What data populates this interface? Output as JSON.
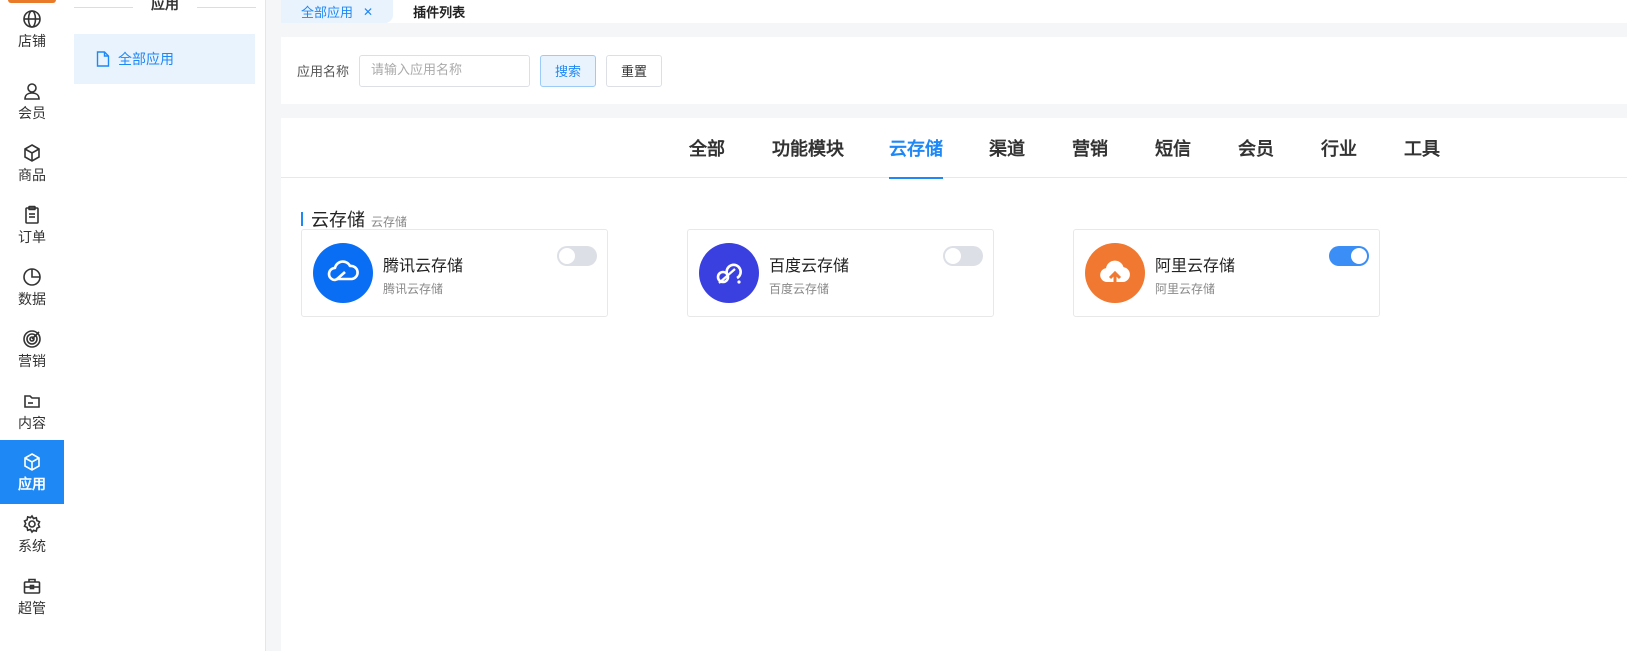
{
  "rail": {
    "items": [
      {
        "label": "店铺",
        "icon": "globe-icon"
      },
      {
        "label": "会员",
        "icon": "user-icon"
      },
      {
        "label": "商品",
        "icon": "box-icon"
      },
      {
        "label": "订单",
        "icon": "clipboard-icon"
      },
      {
        "label": "数据",
        "icon": "pie-chart-icon"
      },
      {
        "label": "营销",
        "icon": "target-icon"
      },
      {
        "label": "内容",
        "icon": "folder-icon"
      },
      {
        "label": "应用",
        "icon": "cube-icon",
        "active": true
      },
      {
        "label": "系统",
        "icon": "gear-icon"
      },
      {
        "label": "超管",
        "icon": "briefcase-icon"
      }
    ]
  },
  "submenu": {
    "title": "应用",
    "item_label": "全部应用"
  },
  "tabs": [
    {
      "label": "全部应用",
      "active": true,
      "closable": true
    },
    {
      "label": "插件列表",
      "active": false
    }
  ],
  "filter": {
    "field_label": "应用名称",
    "placeholder": "请输入应用名称",
    "value": "",
    "search_label": "搜索",
    "reset_label": "重置"
  },
  "categories": [
    "全部",
    "功能模块",
    "云存储",
    "渠道",
    "营销",
    "短信",
    "会员",
    "行业",
    "工具"
  ],
  "active_category": "云存储",
  "group": {
    "title": "云存储",
    "subtitle": "云存储"
  },
  "apps": [
    {
      "name": "腾讯云存储",
      "desc": "腾讯云存储",
      "color": "#0a6ef5",
      "enabled": false
    },
    {
      "name": "百度云存储",
      "desc": "百度云存储",
      "color": "#3a3fe0",
      "enabled": false
    },
    {
      "name": "阿里云存储",
      "desc": "阿里云存储",
      "color": "#f07830",
      "enabled": true
    }
  ],
  "colors": {
    "accent": "#1e88f5",
    "switch_on": "#3a8ef6",
    "switch_off": "#dcdfe6"
  }
}
